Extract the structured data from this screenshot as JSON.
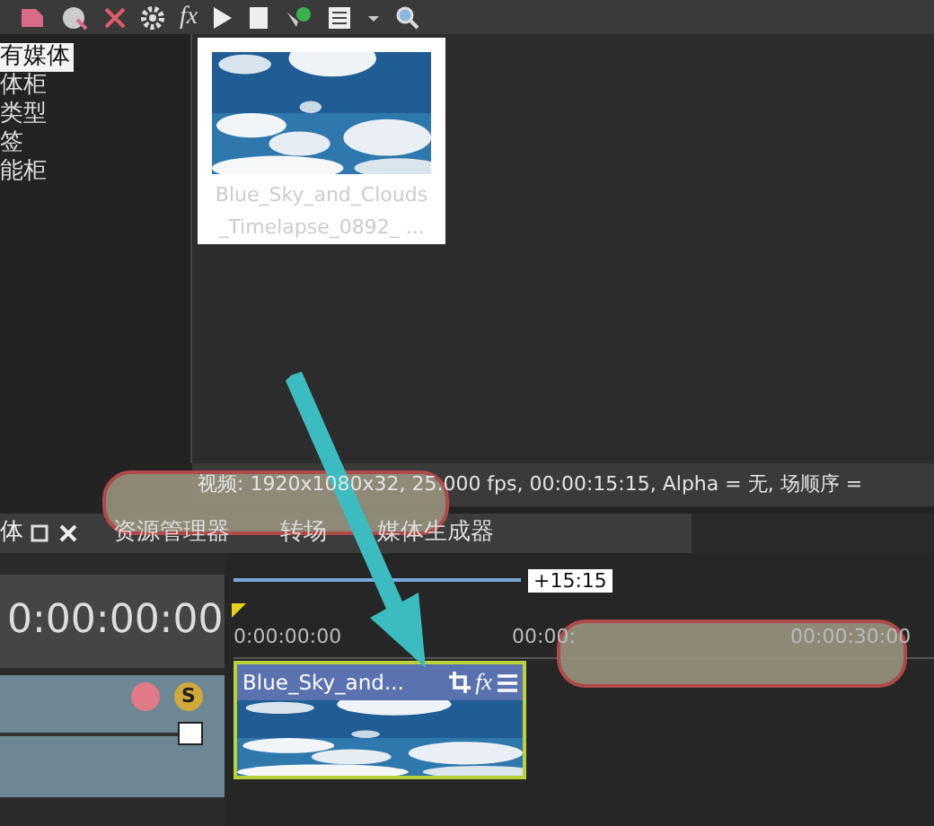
{
  "media_tree": {
    "items": [
      {
        "label": "有媒体",
        "selected": true
      },
      {
        "label": "体柜",
        "selected": false
      },
      {
        "label": "类型",
        "selected": false
      },
      {
        "label": "签",
        "selected": false
      },
      {
        "label": "能柜",
        "selected": false
      }
    ]
  },
  "media_bin": {
    "items": [
      {
        "kind": "picture",
        "caption": [
          "Blue_Sky_and_Clouds",
          "_Timelapse_0892_ ..."
        ]
      }
    ]
  },
  "status_text": "视频: 1920x1080x32, 25.000 fps, 00:00:15:15, Alpha = 无, 场顺序 =",
  "tabs": [
    {
      "label": "体",
      "selected": true
    },
    {
      "label": "资源管理器",
      "selected": false
    },
    {
      "label": "转场",
      "selected": false
    },
    {
      "label": "媒体生成器",
      "selected": false
    }
  ],
  "timeline": {
    "time": "0:00:00:00",
    "loop_length": "+15:15",
    "ruler_labels": [
      "0:00:00:00",
      "00:00:",
      "00:00:30:00"
    ],
    "track": {
      "solo_label": "S",
      "level": 1
    },
    "clip": {
      "title": "Blue_Sky_and...",
      "fx": "fx",
      "selected": true
    }
  },
  "toolbar": {
    "fx": "fx"
  },
  "annotations": [
    {
      "kind": "redaction"
    },
    {
      "kind": "redaction"
    },
    {
      "kind": "arrow"
    }
  ]
}
